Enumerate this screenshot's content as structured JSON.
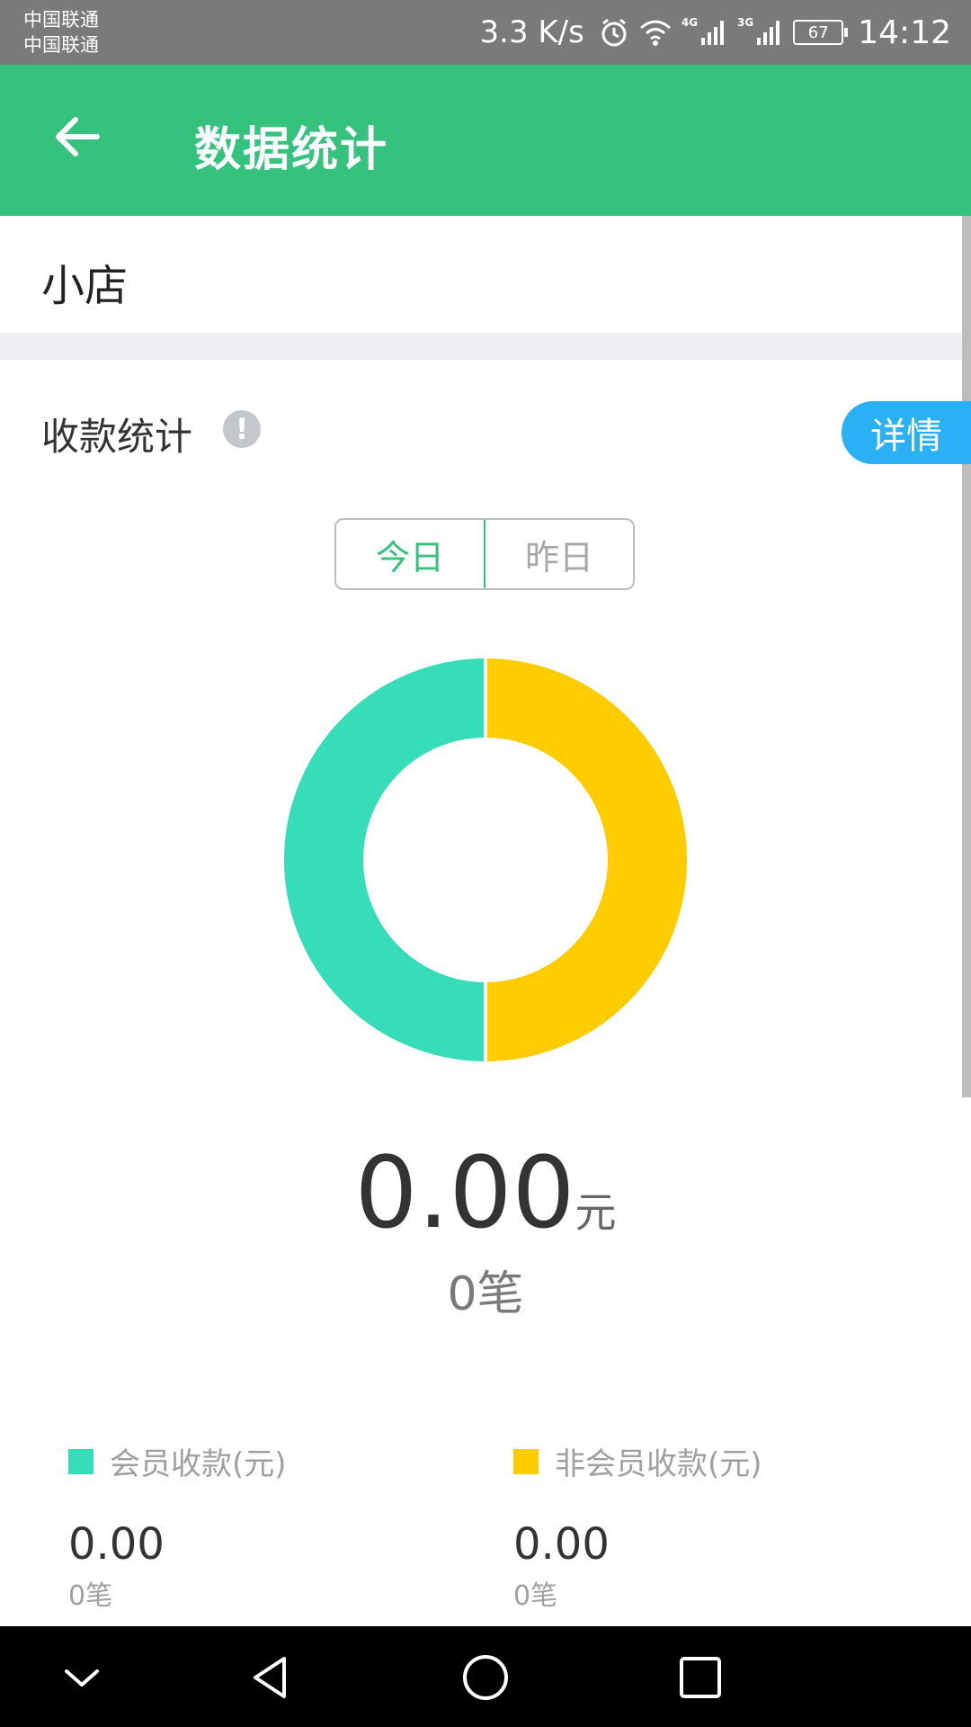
{
  "status_bar": {
    "carrier_1": "中国联通",
    "carrier_2": "中国联通",
    "speed": "3.3 K/s",
    "net_a": "4G",
    "net_b": "3G",
    "battery": "67",
    "time": "14:12",
    "icons": [
      "alarm-icon",
      "wifi-icon",
      "signal-icon",
      "signal-icon",
      "battery-icon"
    ]
  },
  "app_bar": {
    "title": "数据统计",
    "back_icon": "arrow-left-icon",
    "color": "#34c27c"
  },
  "store": {
    "name": "小店"
  },
  "collection": {
    "title": "收款统计",
    "info_icon": "exclamation-circle-icon",
    "info_symbol": "!",
    "detail_label": "详情",
    "detail_color": "#2ab0f4",
    "tabs": [
      {
        "label": "今日",
        "selected": true
      },
      {
        "label": "昨日",
        "selected": false
      }
    ],
    "total_amount": "0.00",
    "total_unit": "元",
    "total_count": "0笔"
  },
  "chart_data": {
    "type": "pie",
    "categories": [
      "会员收款(元)",
      "非会员收款(元)"
    ],
    "values": [
      50,
      50
    ],
    "colors": [
      "#36ddb8",
      "#ffcc00"
    ],
    "donut": true
  },
  "legend": [
    {
      "label": "会员收款(元)",
      "color": "#36ddb8",
      "value": "0.00",
      "count": "0笔"
    },
    {
      "label": "非会员收款(元)",
      "color": "#ffcc00",
      "value": "0.00",
      "count": "0笔"
    }
  ],
  "nav_bar": {
    "icons": [
      "chevron-down-icon",
      "back-triangle-icon",
      "home-circle-icon",
      "recents-square-icon"
    ]
  }
}
